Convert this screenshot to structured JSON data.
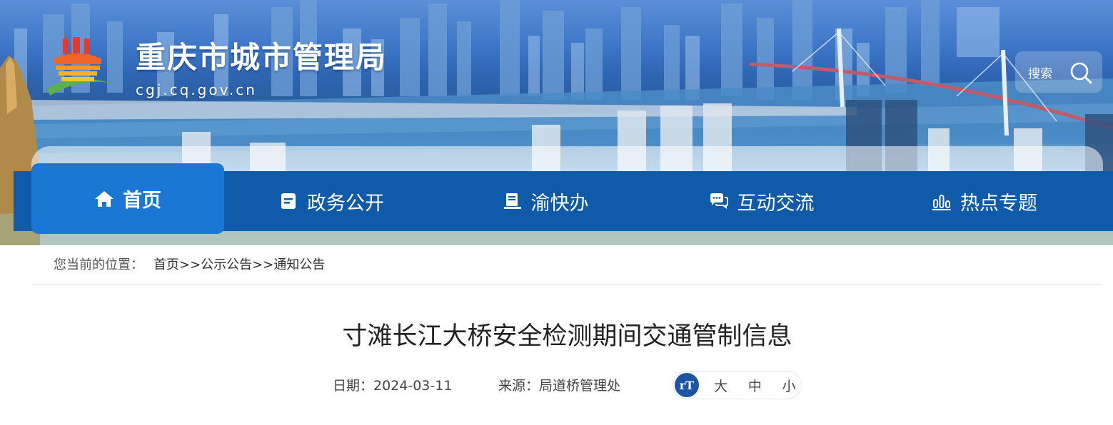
{
  "header": {
    "site_title": "重庆市城市管理局",
    "site_domain": "cgj.cq.gov.cn",
    "search_label": "搜索"
  },
  "nav": {
    "items": [
      {
        "label": "首页",
        "icon": "home-icon",
        "active": true
      },
      {
        "label": "政务公开",
        "icon": "document-icon"
      },
      {
        "label": "渝快办",
        "icon": "desk-icon"
      },
      {
        "label": "互动交流",
        "icon": "chat-icon"
      },
      {
        "label": "热点专题",
        "icon": "bar-chart-icon"
      }
    ]
  },
  "breadcrumb": {
    "prefix": "您当前的位置：",
    "items": [
      "首页",
      "公示公告",
      "通知公告"
    ],
    "separator": ">>"
  },
  "article": {
    "title": "寸滩长江大桥安全检测期间交通管制信息",
    "date": "日期：2024-03-11",
    "source": "来源：局道桥管理处"
  },
  "font_size_control": {
    "icon": "text-size-icon",
    "icon_text": "rT",
    "options": [
      "大",
      "中",
      "小"
    ]
  },
  "colors": {
    "nav_bg": "#0f5aa9",
    "nav_active": "#1a78d4",
    "fontsize_icon_bg": "#1d54a6"
  }
}
